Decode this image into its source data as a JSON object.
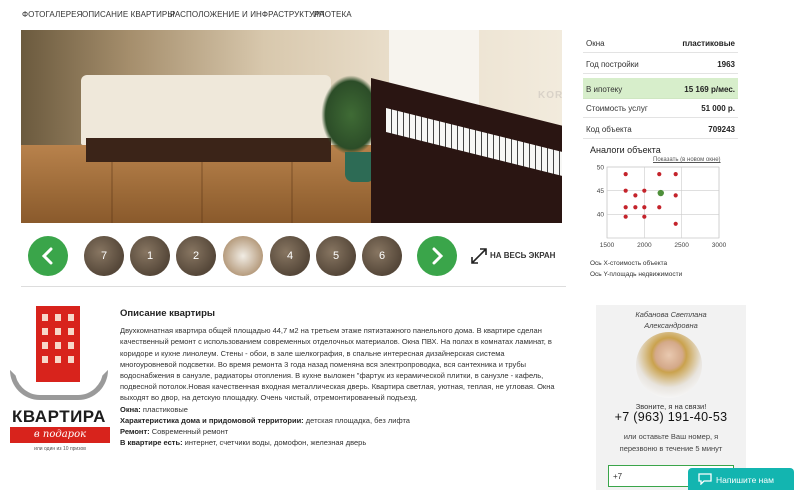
{
  "nav": {
    "items": [
      "Фотогалерея",
      "Описание квартиры",
      "Расположение и инфраструктура",
      "Ипотека"
    ]
  },
  "gallery": {
    "thumbs": [
      "7",
      "1",
      "2",
      "",
      "4",
      "5",
      "6"
    ],
    "fullscreen_label": "НА ВЕСЬ ЭКРАН",
    "photo_brand": "KORG"
  },
  "params": {
    "rows": [
      {
        "label": "Окна",
        "value": "пластиковые"
      },
      {
        "label": "Год постройки",
        "value": "1963"
      },
      {
        "label": "В ипотеку",
        "value": "15 169 р/мес."
      },
      {
        "label": "Стоимость услуг",
        "value": "51 000 р."
      },
      {
        "label": "Код объекта",
        "value": "709243"
      }
    ]
  },
  "analogs": {
    "title": "Аналоги объекта",
    "link": "Показать (в новом окне)",
    "x_note": "Ось X-стоимость объекта",
    "y_note": "Ось Y-площадь недвижимости"
  },
  "chart_data": {
    "type": "scatter",
    "xlim": [
      1500,
      3000
    ],
    "ylim": [
      35,
      50
    ],
    "x_ticks": [
      1500,
      2000,
      2500,
      3000
    ],
    "y_ticks": [
      40,
      45,
      50
    ],
    "grid": true,
    "series": [
      {
        "x": [
          1750,
          1750,
          1750,
          1750,
          1880,
          1880,
          2000,
          2000,
          2000,
          2200,
          2200,
          2420,
          2420,
          2420
        ],
        "y": [
          48.5,
          45,
          41.5,
          39.5,
          44,
          41.5,
          45,
          41.5,
          39.5,
          48.5,
          41.5,
          48.5,
          44,
          38
        ]
      },
      {
        "x": [
          2220
        ],
        "y": [
          44.5
        ]
      }
    ],
    "colors": [
      "#c4232b",
      "#4e8f3a"
    ]
  },
  "description": {
    "title": "Описание квартиры",
    "text": "Двухкомнатная квартира общей площадью 44,7 м2 на третьем этаже пятиэтажного панельного дома. В квартире сделан качественный ремонт с использованием современных отделочных материалов. Окна ПВХ. На полах в комнатах ламинат, в коридоре и кухне линолеум. Стены - обои, в зале шелкография, в спальне интересная дизайнерская система многоуровневой подсветки. Во время ремонта 3 года назад поменяна вся электропроводка, вся сантехника и трубы водоснабжения в санузле, радиаторы отопления. В кухне выложен \"фартук из керамической плитки, в санузле - кафель, подвесной потолок.Новая качественная входная металлическая дверь. Квартира светлая, уютная, теплая, не угловая. Окна выходят во двор, на детскую площадку. Очень чистый, отремонтированный подъезд.",
    "facts": [
      {
        "label": "Окна:",
        "value": "пластиковые"
      },
      {
        "label": "Характеристика дома и придомовой территории:",
        "value": "детская площадка, без лифта"
      },
      {
        "label": "Ремонт:",
        "value": "Современный ремонт"
      },
      {
        "label": "В квартире есть:",
        "value": "интернет, счетчики воды, домофон, железная дверь"
      }
    ]
  },
  "promo": {
    "title": "КВАРТИРА",
    "subtitle": "в подарок",
    "note": "или один из 10 призов"
  },
  "agent": {
    "name_line1": "Кабанова Светлана",
    "name_line2": "Александровна",
    "call": "Звоните, я на связи!",
    "phone": "+7 (963) 191-40-53",
    "leave_line1": "или оставьте Ваш номер, я",
    "leave_line2": "перезвоню в течение 5 минут",
    "input_value": "+7"
  },
  "chat": {
    "label": "Напишите нам"
  },
  "colors": {
    "accent_green": "#3aa54a",
    "mortgage_bg": "#d7eecb",
    "promo_red": "#d8231c",
    "chat_teal": "#13b5b0"
  }
}
